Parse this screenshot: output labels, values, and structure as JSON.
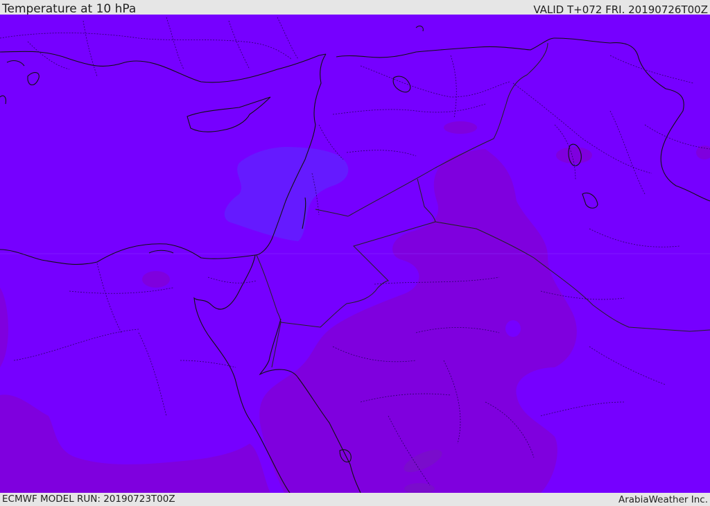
{
  "header": {
    "title": "Temperature at 10 hPa",
    "valid_time": "VALID T+072 FRI. 20190726T00Z"
  },
  "footer": {
    "model_run": "ECMWF MODEL RUN: 20190723T00Z",
    "credit": "ArabiaWeather Inc."
  },
  "map": {
    "region": "Eastern Mediterranean / Middle East",
    "colors": {
      "base": "#7600ff",
      "darker": "#7f00de",
      "darkest": "#7a0ccc",
      "lighter": "#651aff",
      "coast": "#111111",
      "border": "#222222"
    }
  }
}
